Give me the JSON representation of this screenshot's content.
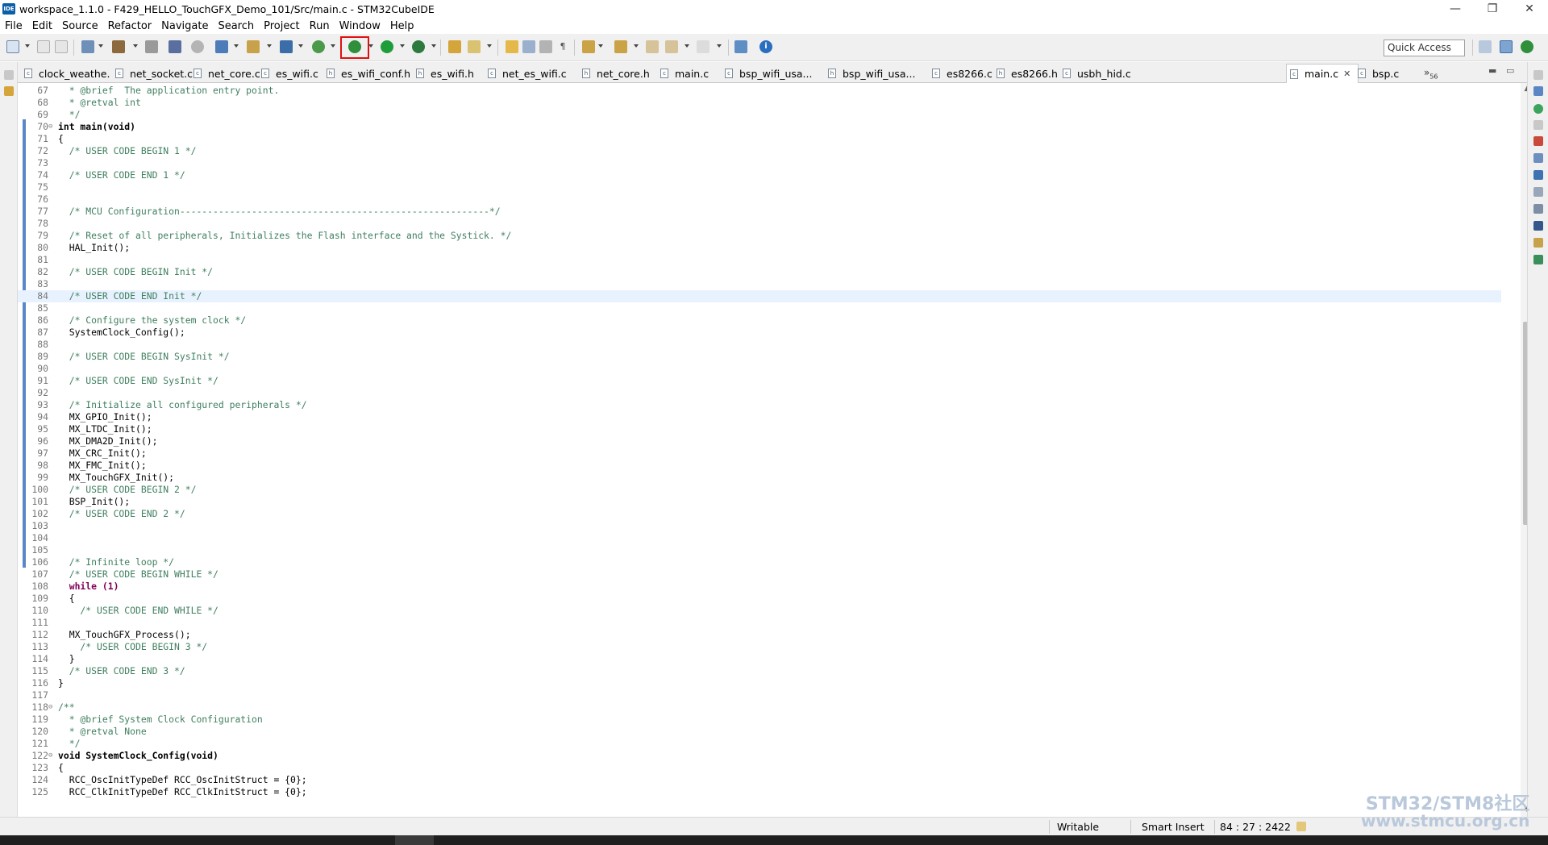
{
  "window": {
    "app_icon": "IDE",
    "title": "workspace_1.1.0 - F429_HELLO_TouchGFX_Demo_101/Src/main.c - STM32CubeIDE",
    "controls": [
      "—",
      "❐",
      "✕"
    ]
  },
  "menu": [
    "File",
    "Edit",
    "Source",
    "Refactor",
    "Navigate",
    "Search",
    "Project",
    "Run",
    "Window",
    "Help"
  ],
  "toolbar": {
    "quick_access_placeholder": "Quick Access"
  },
  "tabs": [
    {
      "label": "clock_weathe...",
      "active": false
    },
    {
      "label": "net_socket.c",
      "active": false
    },
    {
      "label": "net_core.c",
      "active": false
    },
    {
      "label": "es_wifi.c",
      "active": false
    },
    {
      "label": "es_wifi_conf.h",
      "active": false
    },
    {
      "label": "es_wifi.h",
      "active": false
    },
    {
      "label": "net_es_wifi.c",
      "active": false
    },
    {
      "label": "net_core.h",
      "active": false
    },
    {
      "label": "main.c",
      "active": false
    },
    {
      "label": "bsp_wifi_usa...",
      "active": false
    },
    {
      "label": "bsp_wifi_usa...",
      "active": false
    },
    {
      "label": "es8266.c",
      "active": false
    },
    {
      "label": "es8266.h",
      "active": false
    },
    {
      "label": "usbh_hid.c",
      "active": false
    },
    {
      "label": "main.c",
      "active": true
    },
    {
      "label": "bsp.c",
      "active": false
    }
  ],
  "tabs_overflow": {
    "label": "»",
    "count": "56"
  },
  "code": [
    {
      "n": "67",
      "t": "  * @brief  The application entry point.",
      "k": "comment"
    },
    {
      "n": "68",
      "t": "  * @retval int",
      "k": "comment"
    },
    {
      "n": "69",
      "t": "  */",
      "k": "comment"
    },
    {
      "n": "70",
      "t": "int main(void)",
      "k": "decl",
      "fold": "⊖"
    },
    {
      "n": "71",
      "t": "{",
      "k": "plain"
    },
    {
      "n": "72",
      "t": "  /* USER CODE BEGIN 1 */",
      "k": "comment"
    },
    {
      "n": "73",
      "t": "",
      "k": "plain"
    },
    {
      "n": "74",
      "t": "  /* USER CODE END 1 */",
      "k": "comment"
    },
    {
      "n": "75",
      "t": "",
      "k": "plain"
    },
    {
      "n": "76",
      "t": "",
      "k": "plain"
    },
    {
      "n": "77",
      "t": "  /* MCU Configuration--------------------------------------------------------*/",
      "k": "comment"
    },
    {
      "n": "78",
      "t": "",
      "k": "plain"
    },
    {
      "n": "79",
      "t": "  /* Reset of all peripherals, Initializes the Flash interface and the Systick. */",
      "k": "comment"
    },
    {
      "n": "80",
      "t": "  HAL_Init();",
      "k": "plain"
    },
    {
      "n": "81",
      "t": "",
      "k": "plain"
    },
    {
      "n": "82",
      "t": "  /* USER CODE BEGIN Init */",
      "k": "comment"
    },
    {
      "n": "83",
      "t": "",
      "k": "plain"
    },
    {
      "n": "84",
      "t": "  /* USER CODE END Init */",
      "k": "comment",
      "current": true
    },
    {
      "n": "85",
      "t": "",
      "k": "plain"
    },
    {
      "n": "86",
      "t": "  /* Configure the system clock */",
      "k": "comment"
    },
    {
      "n": "87",
      "t": "  SystemClock_Config();",
      "k": "plain"
    },
    {
      "n": "88",
      "t": "",
      "k": "plain"
    },
    {
      "n": "89",
      "t": "  /* USER CODE BEGIN SysInit */",
      "k": "comment"
    },
    {
      "n": "90",
      "t": "",
      "k": "plain"
    },
    {
      "n": "91",
      "t": "  /* USER CODE END SysInit */",
      "k": "comment"
    },
    {
      "n": "92",
      "t": "",
      "k": "plain"
    },
    {
      "n": "93",
      "t": "  /* Initialize all configured peripherals */",
      "k": "comment"
    },
    {
      "n": "94",
      "t": "  MX_GPIO_Init();",
      "k": "plain"
    },
    {
      "n": "95",
      "t": "  MX_LTDC_Init();",
      "k": "plain"
    },
    {
      "n": "96",
      "t": "  MX_DMA2D_Init();",
      "k": "plain"
    },
    {
      "n": "97",
      "t": "  MX_CRC_Init();",
      "k": "plain"
    },
    {
      "n": "98",
      "t": "  MX_FMC_Init();",
      "k": "plain"
    },
    {
      "n": "99",
      "t": "  MX_TouchGFX_Init();",
      "k": "plain"
    },
    {
      "n": "100",
      "t": "  /* USER CODE BEGIN 2 */",
      "k": "comment"
    },
    {
      "n": "101",
      "t": "  BSP_Init();",
      "k": "plain"
    },
    {
      "n": "102",
      "t": "  /* USER CODE END 2 */",
      "k": "comment"
    },
    {
      "n": "103",
      "t": "",
      "k": "plain"
    },
    {
      "n": "104",
      "t": "",
      "k": "plain"
    },
    {
      "n": "105",
      "t": "",
      "k": "plain"
    },
    {
      "n": "106",
      "t": "  /* Infinite loop */",
      "k": "comment"
    },
    {
      "n": "107",
      "t": "  /* USER CODE BEGIN WHILE */",
      "k": "comment"
    },
    {
      "n": "108",
      "t": "  while (1)",
      "k": "kwline"
    },
    {
      "n": "109",
      "t": "  {",
      "k": "plain"
    },
    {
      "n": "110",
      "t": "    /* USER CODE END WHILE */",
      "k": "comment"
    },
    {
      "n": "111",
      "t": "",
      "k": "plain"
    },
    {
      "n": "112",
      "t": "  MX_TouchGFX_Process();",
      "k": "plain"
    },
    {
      "n": "113",
      "t": "    /* USER CODE BEGIN 3 */",
      "k": "comment"
    },
    {
      "n": "114",
      "t": "  }",
      "k": "plain"
    },
    {
      "n": "115",
      "t": "  /* USER CODE END 3 */",
      "k": "comment"
    },
    {
      "n": "116",
      "t": "}",
      "k": "plain"
    },
    {
      "n": "117",
      "t": "",
      "k": "plain"
    },
    {
      "n": "118",
      "t": "/**",
      "k": "comment",
      "fold": "⊖"
    },
    {
      "n": "119",
      "t": "  * @brief System Clock Configuration",
      "k": "comment"
    },
    {
      "n": "120",
      "t": "  * @retval None",
      "k": "comment"
    },
    {
      "n": "121",
      "t": "  */",
      "k": "comment"
    },
    {
      "n": "122",
      "t": "void SystemClock_Config(void)",
      "k": "decl",
      "fold": "⊖"
    },
    {
      "n": "123",
      "t": "{",
      "k": "plain"
    },
    {
      "n": "124",
      "t": "  RCC_OscInitTypeDef RCC_OscInitStruct = {0};",
      "k": "plain"
    },
    {
      "n": "125",
      "t": "  RCC_ClkInitTypeDef RCC_ClkInitStruct = {0};",
      "k": "plain"
    }
  ],
  "status": {
    "writable": "Writable",
    "insert_mode": "Smart Insert",
    "position": "84 : 27 : 2422"
  },
  "watermark": {
    "line1": "STM32/STM8社区",
    "line2": "www.stmcu.org.cn"
  },
  "colors": {
    "comment": "#3f7f5f",
    "keyword": "#7f0055",
    "current_line": "#e8f2fe",
    "highlight_box": "#e01010"
  }
}
